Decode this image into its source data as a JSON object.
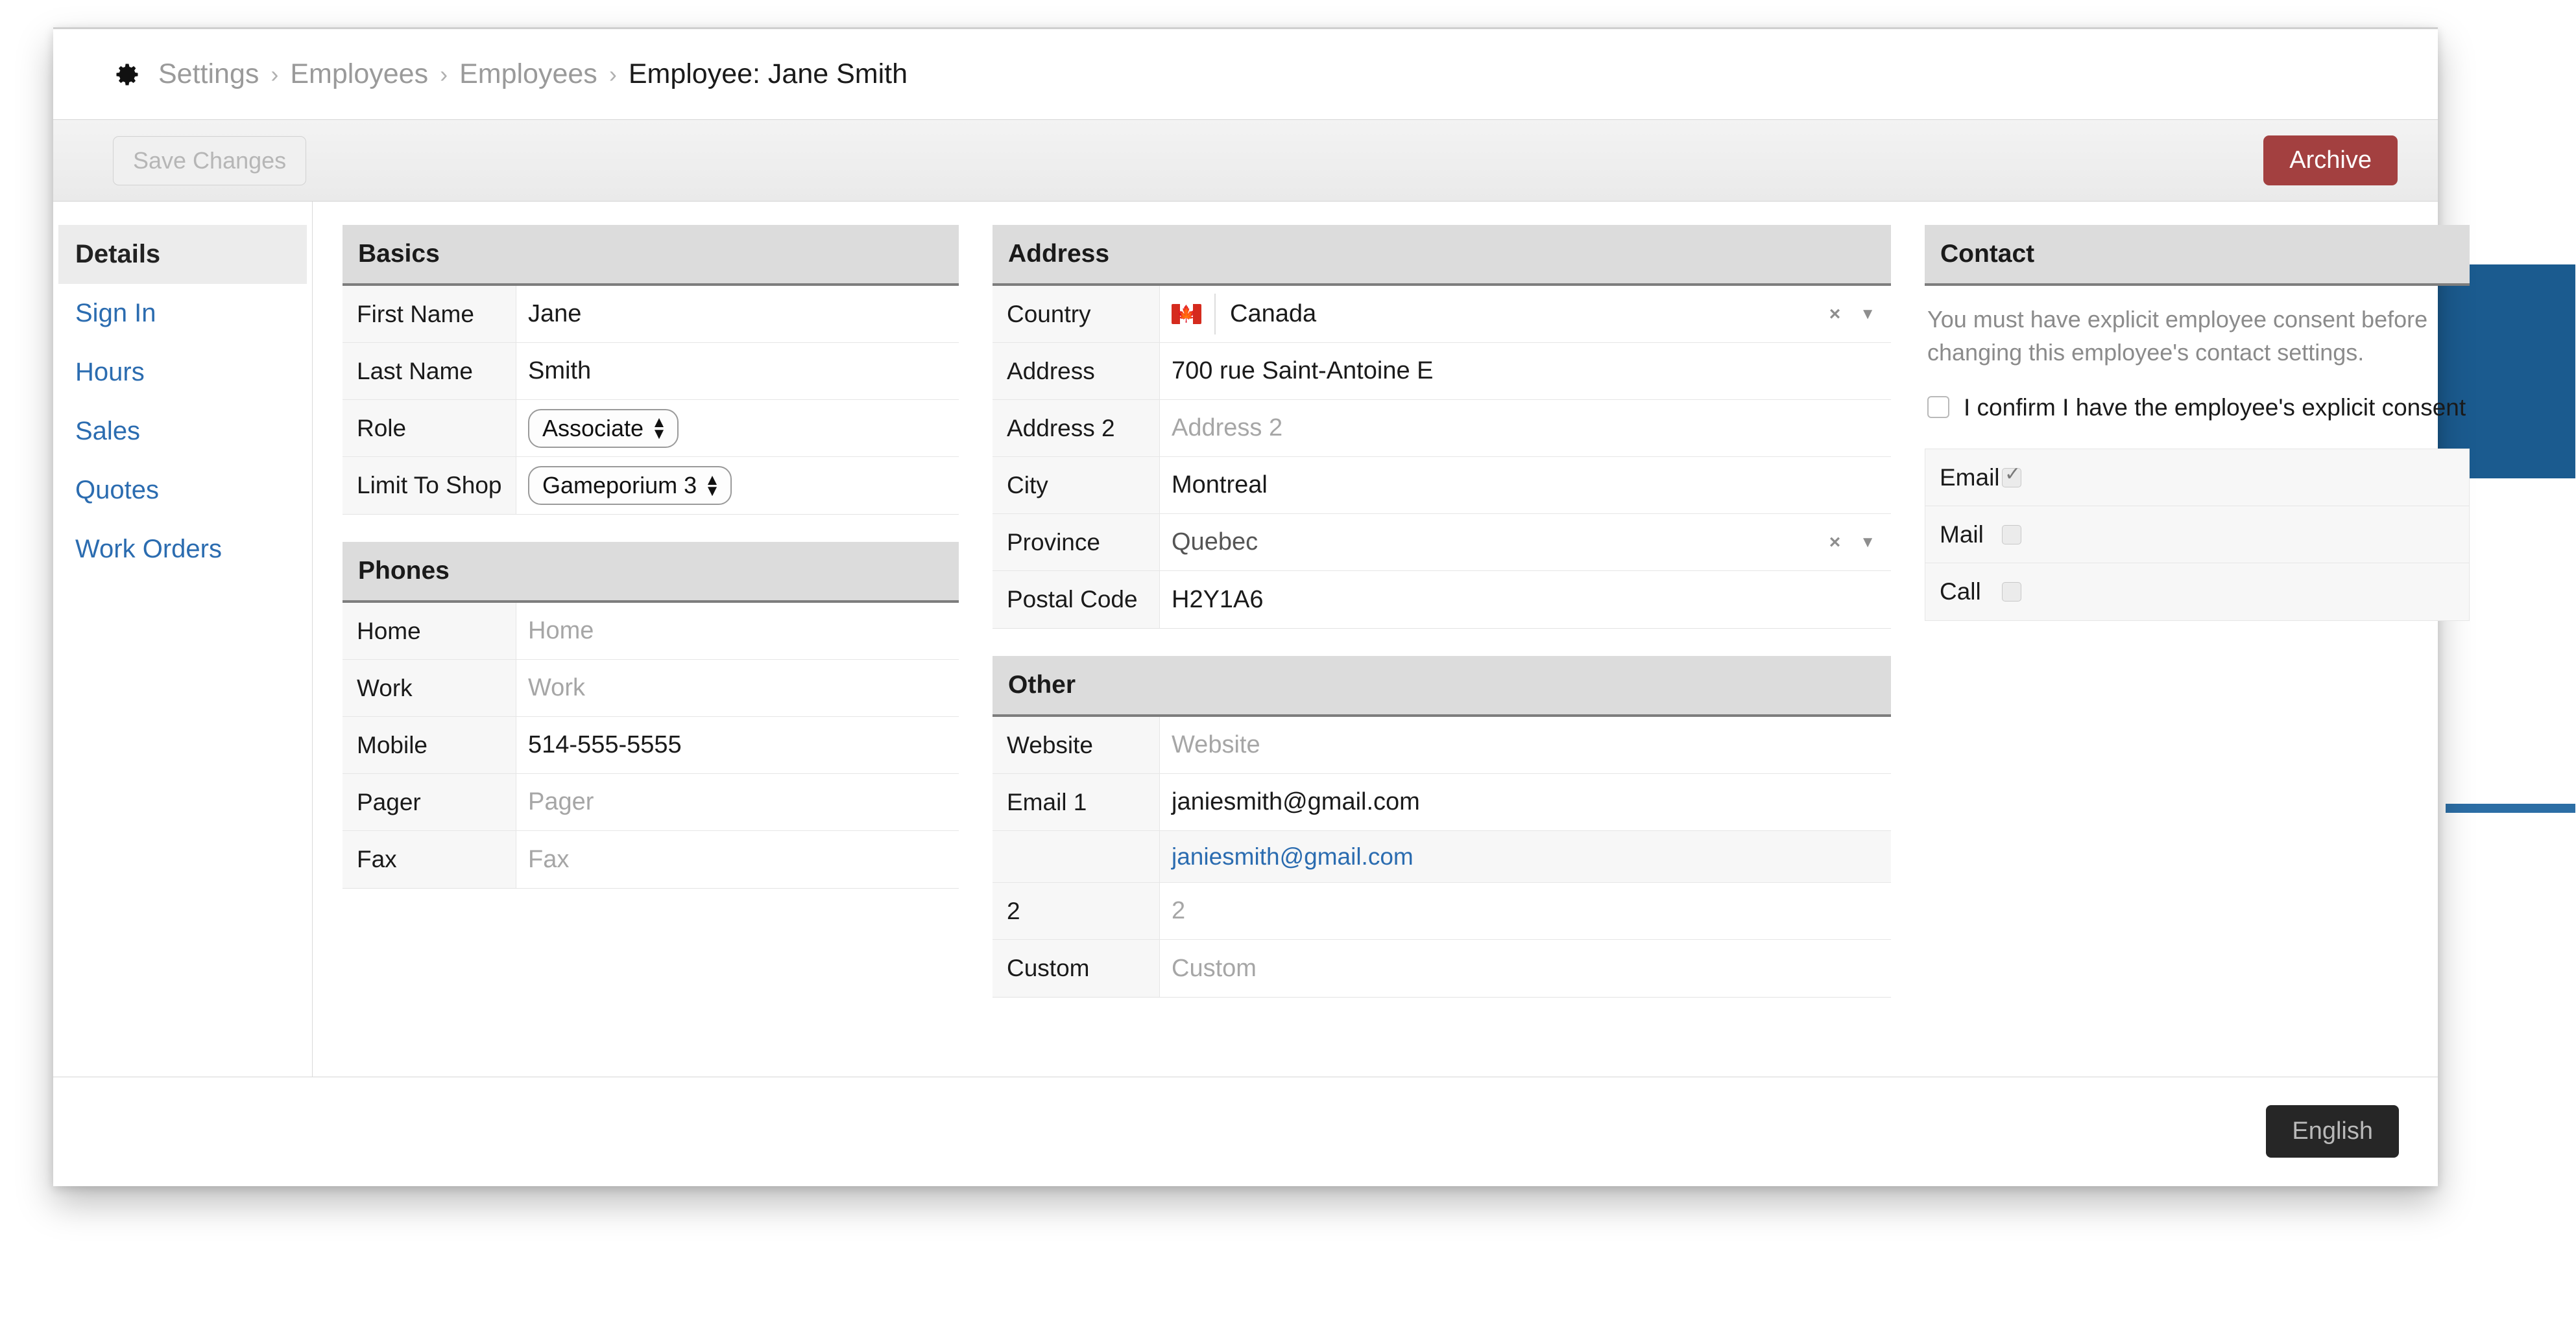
{
  "breadcrumb": {
    "gear_icon": "gear-icon",
    "separator": "›",
    "items": [
      {
        "label": "Settings",
        "active": false
      },
      {
        "label": "Employees",
        "active": false
      },
      {
        "label": "Employees",
        "active": false
      },
      {
        "label": "Employee: Jane Smith",
        "active": true
      }
    ]
  },
  "toolbar": {
    "save_label": "Save Changes",
    "archive_label": "Archive",
    "archive_color": "#a34040"
  },
  "sidebar": {
    "items": [
      {
        "label": "Details"
      },
      {
        "label": "Sign In"
      },
      {
        "label": "Hours"
      },
      {
        "label": "Sales"
      },
      {
        "label": "Quotes"
      },
      {
        "label": "Work Orders"
      }
    ],
    "link_color": "#2b6cb0",
    "active_bg": "#ececec"
  },
  "basics": {
    "title": "Basics",
    "first_name": {
      "label": "First Name",
      "value": "Jane"
    },
    "last_name": {
      "label": "Last Name",
      "value": "Smith"
    },
    "role": {
      "label": "Role",
      "value": "Associate"
    },
    "limit_to_shop": {
      "label": "Limit To Shop",
      "value": "Gameporium 3"
    }
  },
  "phones": {
    "title": "Phones",
    "rows": [
      {
        "label": "Home",
        "value": "Home",
        "is_placeholder": true
      },
      {
        "label": "Work",
        "value": "Work",
        "is_placeholder": true
      },
      {
        "label": "Mobile",
        "value": "514-555-5555",
        "is_placeholder": false
      },
      {
        "label": "Pager",
        "value": "Pager",
        "is_placeholder": true
      },
      {
        "label": "Fax",
        "value": "Fax",
        "is_placeholder": true
      }
    ]
  },
  "address": {
    "title": "Address",
    "country": {
      "label": "Country",
      "value": "Canada",
      "flag_icon": "canada-flag-icon",
      "clear_icon": "×",
      "caret_icon": "▼"
    },
    "address1": {
      "label": "Address",
      "value": "700 rue Saint-Antoine E"
    },
    "address2": {
      "label": "Address 2",
      "value": "Address 2"
    },
    "city": {
      "label": "City",
      "value": "Montreal"
    },
    "province": {
      "label": "Province",
      "value": "Quebec",
      "clear_icon": "×",
      "caret_icon": "▼"
    },
    "postal_code": {
      "label": "Postal Code",
      "value": "H2Y1A6"
    }
  },
  "other": {
    "title": "Other",
    "website": {
      "label": "Website",
      "value": "Website"
    },
    "email1": {
      "label": "Email 1",
      "value": "janiesmith@gmail.com"
    },
    "email1_link": "janiesmith@gmail.com",
    "email2": {
      "label": "2",
      "value": "2"
    },
    "custom": {
      "label": "Custom",
      "value": "Custom"
    }
  },
  "contact": {
    "title": "Contact",
    "notice": "You must have explicit employee consent before changing this employee's contact settings.",
    "consent_label": "I confirm I have the employee's explicit consent",
    "consent_checked": false,
    "channels": [
      {
        "label": "Email",
        "checked": true
      },
      {
        "label": "Mail",
        "checked": false
      },
      {
        "label": "Call",
        "checked": false
      }
    ]
  },
  "footer": {
    "language_label": "English"
  }
}
